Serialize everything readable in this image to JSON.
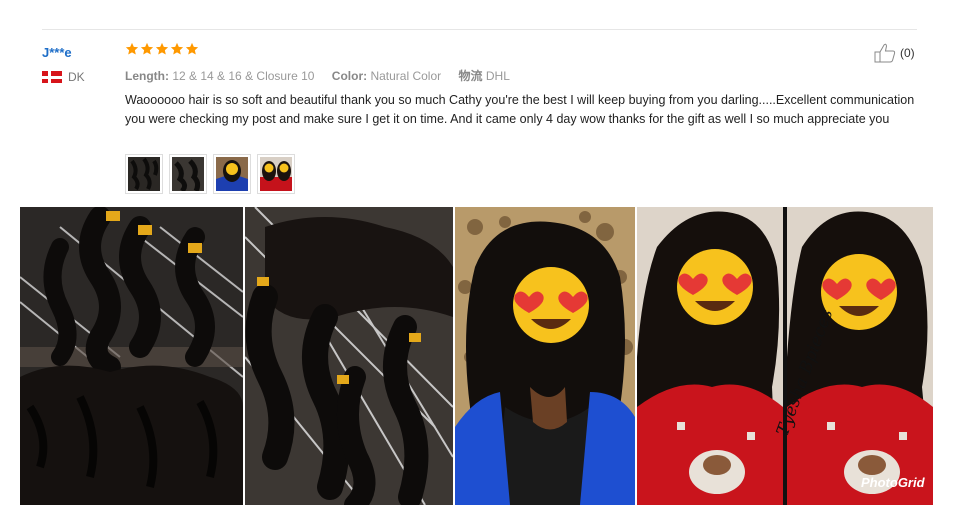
{
  "review": {
    "user_name": "J***e",
    "country_code": "DK",
    "rating": 5,
    "rating_max": 5,
    "length_label": "Length:",
    "length_value": "12 & 14 & 16 & Closure 10",
    "color_label": "Color:",
    "color_value": "Natural Color",
    "shipping_label": "物流",
    "shipping_value": "DHL",
    "helpful_count": "(0)",
    "text": "Waoooooo hair is so soft and beautiful thank you so much Cathy you're the best I will keep buying from you darling.....Excellent communication you were checking my post and make sure I get it on time. And it came only 4 day wow thanks for the gift as well I so much appreciate you"
  },
  "photos": {
    "watermark_text": "Tyesha Bpieces",
    "photogrid_label": "PhotoGrid"
  },
  "colors": {
    "user_name": "#1e6ec8",
    "star": "#ff9900",
    "flag_red": "#d7141a"
  },
  "icons": [
    "star-icon",
    "thumbs-up-icon",
    "denmark-flag-icon",
    "heart-eyes-emoji-icon"
  ]
}
